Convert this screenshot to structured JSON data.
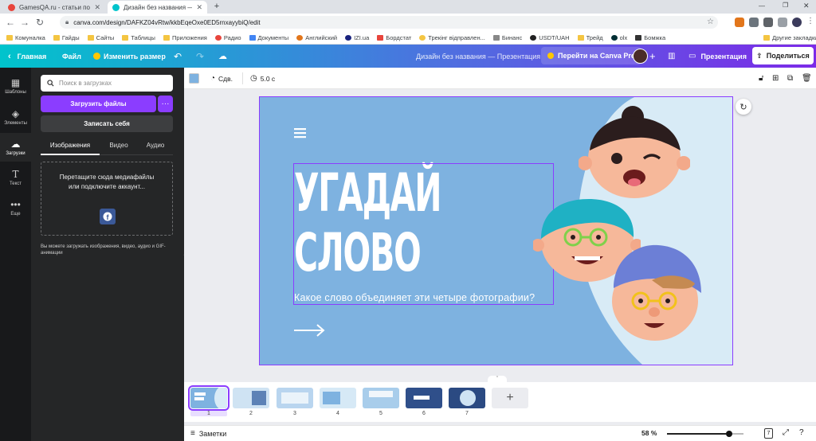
{
  "browser": {
    "tabs": [
      {
        "title": "GamesQA.ru - статьи по решени...",
        "favicon_color": "#e8453c"
      },
      {
        "title": "Дизайн без названия — Презент",
        "favicon_color": "#00c4cc"
      }
    ],
    "new_tab": "+",
    "url": "canva.com/design/DAFKZ04vRtw/kkbEqeOxe0ED5rnxayybiQ/edit",
    "bookmarks": [
      "Комуналка",
      "Гайды",
      "Сайты",
      "Таблицы",
      "Приложения",
      "Радио",
      "Документы",
      "Английский",
      "IZI.ua",
      "Бордстат",
      "Трекінг відправлен...",
      "Бинанс",
      "USDT/UAH",
      "Трейд",
      "olx",
      "Бомжка"
    ],
    "other_bookmarks": "Другие закладки"
  },
  "canva_header": {
    "home": "Главная",
    "file": "Файл",
    "resize": "Изменить размер",
    "design_title": "Дизайн без названия — Презентация",
    "go_pro": "Перейти на Canva Pro",
    "present": "Презентация",
    "share": "Поделиться"
  },
  "sidebar": {
    "items": [
      {
        "label": "Шаблоны",
        "icon": "grid-icon"
      },
      {
        "label": "Элементы",
        "icon": "shapes-icon"
      },
      {
        "label": "Загрузки",
        "icon": "upload-cloud-icon"
      },
      {
        "label": "Текст",
        "icon": "text-icon"
      },
      {
        "label": "Еще",
        "icon": "more-dots-icon"
      }
    ]
  },
  "upload_panel": {
    "search_placeholder": "Поиск в загрузках",
    "upload_button": "Загрузить файлы",
    "more": "···",
    "record_button": "Записать себя",
    "tabs": [
      "Изображения",
      "Видео",
      "Аудио"
    ],
    "dropzone_text": "Перетащите сюда медиафайлы или подключите аккаунт...",
    "note": "Вы можете загружать изображения, видео, аудио и GIF-анимации"
  },
  "toolbar": {
    "swatch_color": "#7eb2e0",
    "animate": "Сдв.",
    "duration": "5.0 с"
  },
  "slide": {
    "title": "УГАДАЙ\nСЛОВО",
    "subtitle": "Какое слово объединяет эти четыре фотографии?",
    "background_color": "#7eb2e0",
    "accent_color": "#d8ebf6"
  },
  "filmstrip": {
    "pages": [
      "1",
      "2",
      "3",
      "4",
      "5",
      "6",
      "7"
    ],
    "add": "+",
    "selected_page": 1
  },
  "footer": {
    "notes": "Заметки",
    "zoom": "58 %",
    "zoom_level": 0.58,
    "page_count": "7"
  }
}
